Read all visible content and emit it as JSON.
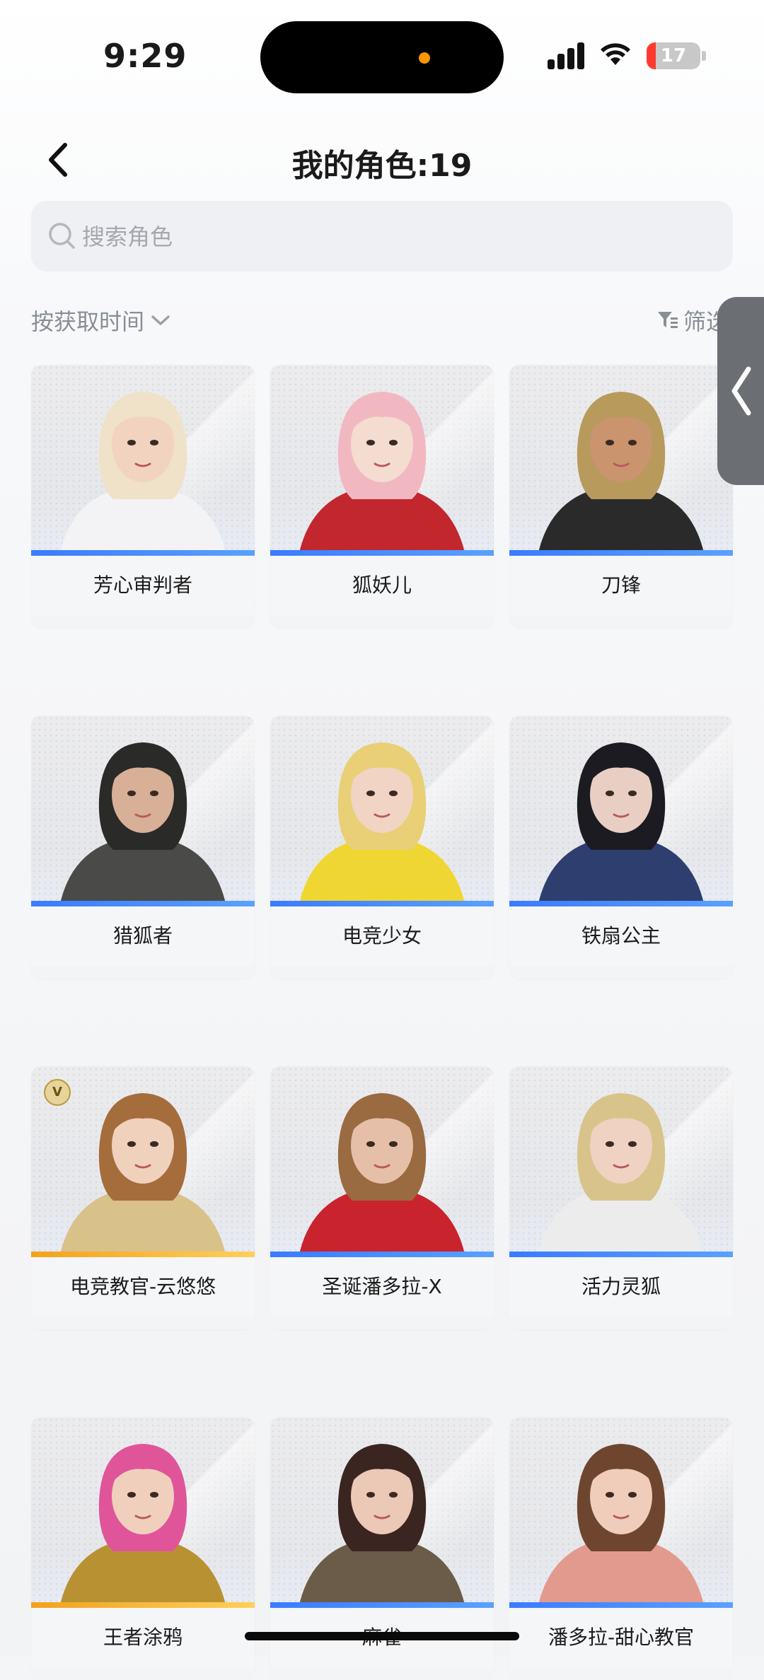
{
  "status_bar": {
    "time": "9:29",
    "battery": "17",
    "battery_level": 0.17
  },
  "header": {
    "title": "我的角色:19"
  },
  "search": {
    "placeholder": "搜索角色"
  },
  "sort": {
    "label": "按获取时间"
  },
  "filter": {
    "label": "筛选"
  },
  "characters": [
    {
      "name": "芳心审判者",
      "rarity": "blue",
      "hair": "#efe2c8",
      "outfit": "#f3f3f5",
      "skin": "#f2d3c0"
    },
    {
      "name": "狐妖儿",
      "rarity": "blue",
      "hair": "#f2b8c2",
      "outfit": "#c2272d",
      "skin": "#f4dcd0"
    },
    {
      "name": "刀锋",
      "rarity": "blue",
      "hair": "#b89a5c",
      "outfit": "#2b2a2a",
      "skin": "#c9946e"
    },
    {
      "name": "猎狐者",
      "rarity": "blue",
      "hair": "#2a2a28",
      "outfit": "#4a4a48",
      "skin": "#d8b098"
    },
    {
      "name": "电竞少女",
      "rarity": "blue",
      "hair": "#e9cf76",
      "outfit": "#f0d633",
      "skin": "#f2d4c4"
    },
    {
      "name": "铁扇公主",
      "rarity": "blue",
      "hair": "#1c1b22",
      "outfit": "#2e3e6e",
      "skin": "#e9cfc3"
    },
    {
      "name": "电竞教官-云悠悠",
      "rarity": "gold",
      "badge": "V",
      "hair": "#a56c3c",
      "outfit": "#d9c28a",
      "skin": "#f0d1bc"
    },
    {
      "name": "圣诞潘多拉-X",
      "rarity": "blue",
      "hair": "#9a6a40",
      "outfit": "#c9232e",
      "skin": "#e6bfa8"
    },
    {
      "name": "活力灵狐",
      "rarity": "blue",
      "hair": "#d8c48a",
      "outfit": "#ececec",
      "skin": "#efd2c2"
    },
    {
      "name": "王者涂鸦",
      "rarity": "gold",
      "hair": "#e0559a",
      "outfit": "#b89232",
      "skin": "#f0d0bd"
    },
    {
      "name": "麻雀",
      "rarity": "blue",
      "hair": "#3a2520",
      "outfit": "#6a5c48",
      "skin": "#ecc8b6"
    },
    {
      "name": "潘多拉-甜心教官",
      "rarity": "blue",
      "hair": "#6e4630",
      "outfit": "#e39a8e",
      "skin": "#f0cdbb"
    }
  ],
  "colors": {
    "rarity_blue": "#3a7bff",
    "rarity_gold": "#f3a21b",
    "battery_low": "#ff3b30"
  },
  "icons": [
    "back-chevron-icon",
    "search-icon",
    "sort-chevron-down-icon",
    "filter-icon",
    "collapse-chevron-icon"
  ]
}
